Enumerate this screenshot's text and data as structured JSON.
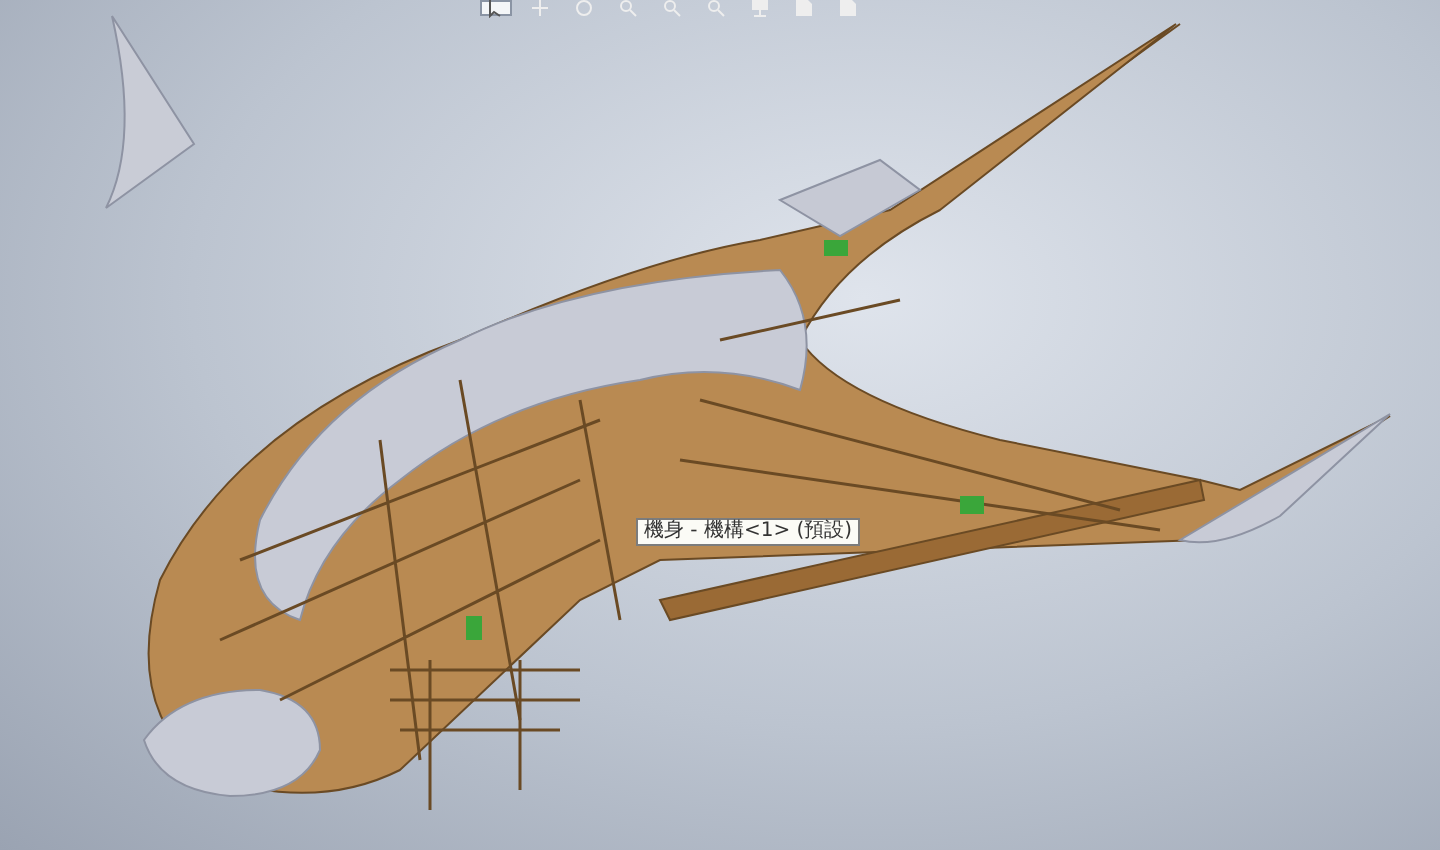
{
  "viewport": {
    "toolbar": [
      {
        "kind": "select",
        "selected": true
      },
      {
        "kind": "pan",
        "selected": false
      },
      {
        "kind": "rotate",
        "selected": false
      },
      {
        "kind": "zoom",
        "selected": false
      },
      {
        "kind": "zoom",
        "selected": false
      },
      {
        "kind": "zoom",
        "selected": false
      },
      {
        "kind": "display",
        "selected": false
      },
      {
        "kind": "view",
        "selected": false
      },
      {
        "kind": "view",
        "selected": false
      }
    ],
    "tooltip": "機身 - 機構<1> (預設)"
  }
}
